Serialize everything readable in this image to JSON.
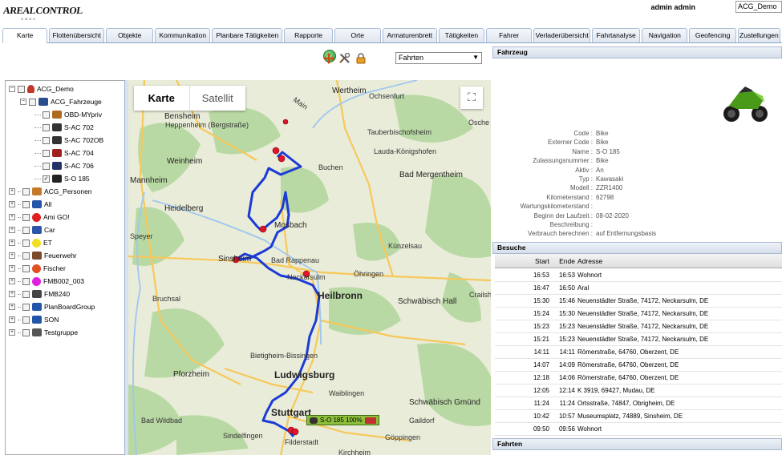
{
  "header": {
    "logo_text": "AREALCONTROL",
    "logo_sub": "GMBH",
    "user": "admin admin",
    "tenant": "ACG_Demo"
  },
  "tabs": [
    "Karte",
    "Flottenübersicht",
    "Objekte",
    "Kommunikation",
    "Planbare Tätigkeiten",
    "Rapporte",
    "Orte",
    "Armaturenbrett",
    "Tätigkeiten",
    "Fahrer",
    "Verladerübersicht",
    "Fahrtanalyse",
    "Navigation",
    "Geofencing",
    "Zustellungen"
  ],
  "toolbar": {
    "view_select": "Fahrten"
  },
  "tree": {
    "root": "ACG_Demo",
    "vehicles_group": "ACG_Fahrzeuge",
    "vehicles": [
      "OBD-MYpriv",
      "S-AC 702",
      "S-AC 702OB",
      "S-AC 704",
      "S-AC 706",
      "S-O 185"
    ],
    "groups": [
      "ACG_Personen",
      "All",
      "Ami GO!",
      "Car",
      "ET",
      "Feuerwehr",
      "Fischer",
      "FMB002_003",
      "FMB240",
      "PlanBoardGroup",
      "SON",
      "Testgruppe"
    ]
  },
  "map": {
    "type_karte": "Karte",
    "type_satellit": "Satellit",
    "fullscreen_icon": "⛶",
    "vehicle_label": "S-O 185 100%",
    "cities": [
      "Wertheim",
      "Bensheim",
      "Heppenheim (Bergstraße)",
      "Weinheim",
      "Mannheim",
      "Heidelberg",
      "Speyer",
      "Sinsheim",
      "Mosbach",
      "Bad Rappenau",
      "Neckarsulm",
      "Heilbronn",
      "Buchen",
      "Tauberbischofsheim",
      "Lauda-Königshofen",
      "Bad Mergentheim",
      "Künzelsau",
      "Öhringen",
      "Schwäbisch Hall",
      "Crailsh",
      "Bruchsal",
      "Bietigheim-Bissingen",
      "Pforzheim",
      "Ludwigsburg",
      "Waiblingen",
      "Schwäbisch Gmünd",
      "Stuttgart",
      "Sindelfingen",
      "Filderstadt",
      "Göppingen",
      "Kirchheim",
      "Bad Wildbad",
      "Gaildorf",
      "Ochsenfurt",
      "Osche",
      "Main"
    ]
  },
  "vehicle_panel": {
    "title": "Fahrzeug",
    "fields": [
      {
        "k": "Code :",
        "v": "Bike"
      },
      {
        "k": "Externer Code :",
        "v": "Bike"
      },
      {
        "k": "Name :",
        "v": "S-O 185"
      },
      {
        "k": "Zulassungsnummer :",
        "v": "Bike"
      },
      {
        "k": "Aktiv :",
        "v": "An"
      },
      {
        "k": "Typ :",
        "v": "Kawasaki"
      },
      {
        "k": "Modell :",
        "v": "ZZR1400"
      },
      {
        "k": "Kilometerstand :",
        "v": "62798"
      },
      {
        "k": "Wartungskilometerstand :",
        "v": ""
      },
      {
        "k": "Beginn der Laufzeit :",
        "v": "08-02-2020"
      },
      {
        "k": "Beschreibung :",
        "v": ""
      },
      {
        "k": "Verbrauch berechnen :",
        "v": "auf Entfernungsbasis"
      }
    ]
  },
  "visits_panel": {
    "title": "Besuche",
    "columns": [
      "Start",
      "Ende",
      "Adresse"
    ],
    "rows": [
      [
        "16:53",
        "16:53",
        "Wohnort"
      ],
      [
        "16:47",
        "16:50",
        "Aral"
      ],
      [
        "15:30",
        "15:46",
        "Neuenstädter Straße, 74172, Neckarsulm, DE"
      ],
      [
        "15:24",
        "15:30",
        "Neuenstädter Straße, 74172, Neckarsulm, DE"
      ],
      [
        "15:23",
        "15:23",
        "Neuenstädter Straße, 74172, Neckarsulm, DE"
      ],
      [
        "15:21",
        "15:23",
        "Neuenstädter Straße, 74172, Neckarsulm, DE"
      ],
      [
        "14:11",
        "14:11",
        "Römerstraße, 64760, Oberzent, DE"
      ],
      [
        "14:07",
        "14:09",
        "Römerstraße, 64760, Oberzent, DE"
      ],
      [
        "12:18",
        "14:06",
        "Römerstraße, 64760, Oberzent, DE"
      ],
      [
        "12:05",
        "12:14",
        "K 3919, 69427, Mudau, DE"
      ],
      [
        "11:24",
        "11:24",
        "Ortsstraße, 74847, Obrigheim, DE"
      ],
      [
        "10:42",
        "10:57",
        "Museumsplatz, 74889, Sinsheim, DE"
      ],
      [
        "09:50",
        "09:56",
        "Wohnort"
      ]
    ]
  },
  "trips_panel": {
    "title": "Fahrten"
  }
}
